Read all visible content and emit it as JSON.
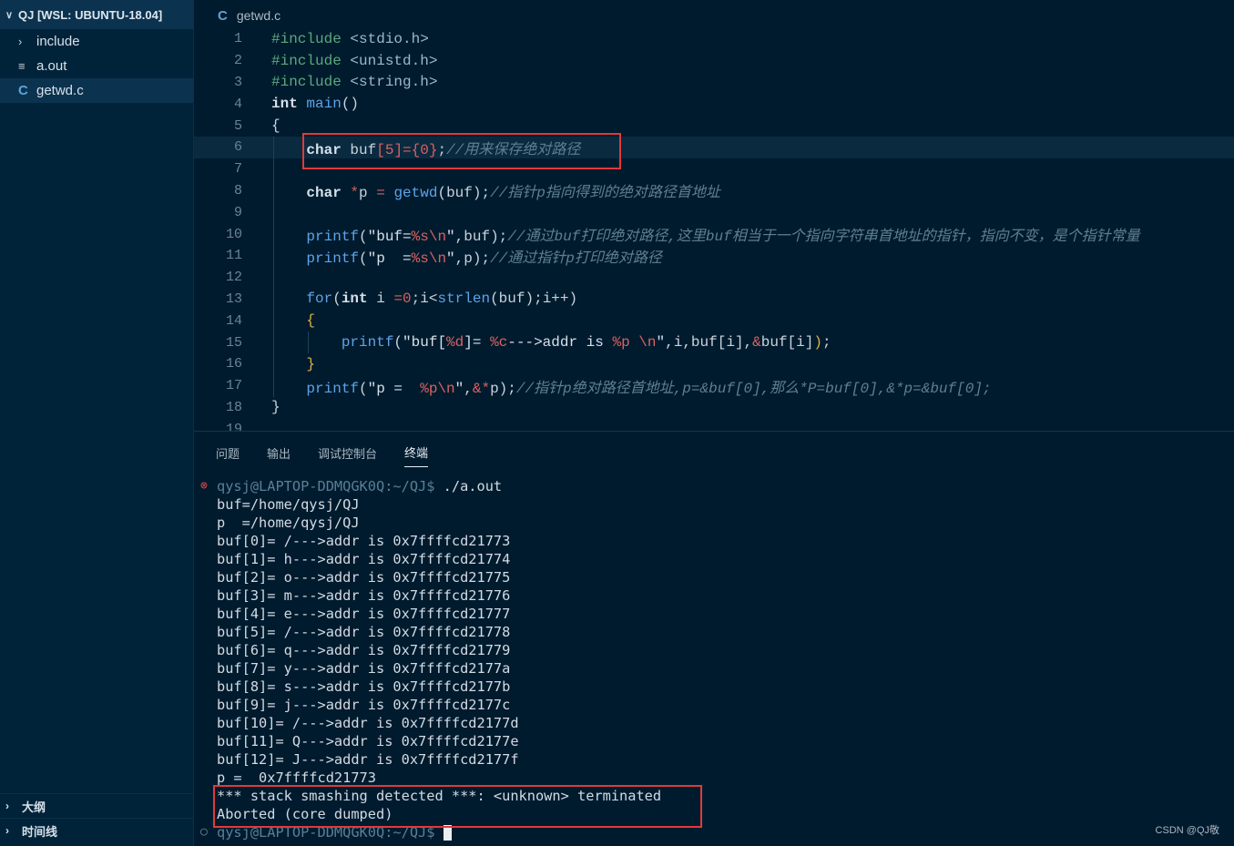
{
  "sidebar": {
    "header": "QJ [WSL: UBUNTU-18.04]",
    "items": [
      {
        "label": "include",
        "icon": "chevron-right-icon"
      },
      {
        "label": "a.out",
        "icon": "file-lines-icon"
      },
      {
        "label": "getwd.c",
        "icon": "c-file-icon"
      }
    ],
    "bottom": [
      {
        "label": "大纲"
      },
      {
        "label": "时间线"
      }
    ]
  },
  "editor": {
    "tab_title": "getwd.c",
    "line_numbers": [
      "1",
      "2",
      "3",
      "4",
      "5",
      "6",
      "7",
      "8",
      "9",
      "10",
      "11",
      "12",
      "13",
      "14",
      "15",
      "16",
      "17",
      "18",
      "19"
    ]
  },
  "panel": {
    "tabs": [
      "问题",
      "输出",
      "调试控制台",
      "终端"
    ],
    "active_tab": "终端",
    "terminal": {
      "prompt_user": "qysj@LAPTOP-DDMQGK0Q:~/QJ$",
      "command": " ./a.out",
      "lines": [
        "buf=/home/qysj/QJ",
        "p  =/home/qysj/QJ",
        "buf[0]= /--->addr is 0x7ffffcd21773",
        "buf[1]= h--->addr is 0x7ffffcd21774",
        "buf[2]= o--->addr is 0x7ffffcd21775",
        "buf[3]= m--->addr is 0x7ffffcd21776",
        "buf[4]= e--->addr is 0x7ffffcd21777",
        "buf[5]= /--->addr is 0x7ffffcd21778",
        "buf[6]= q--->addr is 0x7ffffcd21779",
        "buf[7]= y--->addr is 0x7ffffcd2177a",
        "buf[8]= s--->addr is 0x7ffffcd2177b",
        "buf[9]= j--->addr is 0x7ffffcd2177c",
        "buf[10]= /--->addr is 0x7ffffcd2177d",
        "buf[11]= Q--->addr is 0x7ffffcd2177e",
        "buf[12]= J--->addr is 0x7ffffcd2177f",
        "p =  0x7ffffcd21773",
        "*** stack smashing detected ***: <unknown> terminated",
        "Aborted (core dumped)"
      ],
      "final_prompt": "qysj@LAPTOP-DDMQGK0Q:~/QJ$"
    }
  },
  "watermark": "CSDN @QJ敬",
  "colors": {
    "background": "#001b2e",
    "highlight_box": "#e03a3a",
    "function": "#5ea3e8",
    "comment": "#5f7f93"
  }
}
